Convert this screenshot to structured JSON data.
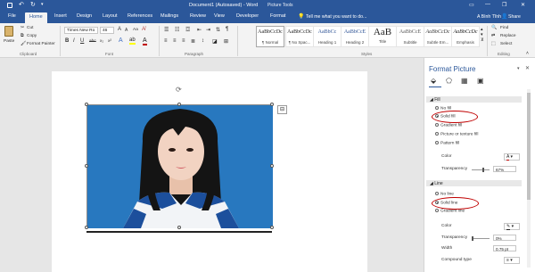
{
  "titlebar": {
    "title": "Document1 (Autosaved) - Word",
    "context_tab_group": "Picture Tools",
    "minimize_icon": "—",
    "restore_icon": "❐",
    "close_icon": "✕"
  },
  "tabs": [
    "File",
    "Home",
    "Insert",
    "Design",
    "Layout",
    "References",
    "Mailings",
    "Review",
    "View",
    "Developer",
    "Format"
  ],
  "tell_me": "Tell me what you want to do...",
  "user": "A Bình Tĩnh",
  "share": "Share",
  "clipboard": {
    "paste": "Paste",
    "cut": "Cut",
    "copy": "Copy",
    "format_painter": "Format Painter",
    "label": "Clipboard"
  },
  "font": {
    "name": "Times New Ro",
    "size": "46",
    "bold": "B",
    "italic": "I",
    "underline": "U",
    "strike": "abc",
    "sub": "x₂",
    "sup": "x²",
    "grow": "A",
    "shrink": "A",
    "case": "Aa",
    "label": "Font"
  },
  "paragraph": {
    "label": "Paragraph"
  },
  "styles": {
    "items": [
      {
        "preview": "AaBbCcDc",
        "name": "¶ Normal"
      },
      {
        "preview": "AaBbCcDc",
        "name": "¶ No Spac..."
      },
      {
        "preview": "AaBbCc",
        "name": "Heading 1"
      },
      {
        "preview": "AaBbCcE",
        "name": "Heading 2"
      },
      {
        "preview": "AaB",
        "name": "Title"
      },
      {
        "preview": "AaBbCcE",
        "name": "Subtitle"
      },
      {
        "preview": "AaBbCcDc",
        "name": "Subtle Em..."
      },
      {
        "preview": "AaBbCcDc",
        "name": "Emphasis"
      }
    ],
    "label": "Styles"
  },
  "editing": {
    "find": "Find",
    "replace": "Replace",
    "select": "Select",
    "label": "Editing"
  },
  "pane": {
    "title": "Format Picture",
    "close": "✕",
    "fill": {
      "header": "Fill",
      "options": [
        "No fill",
        "Solid fill",
        "Gradient fill",
        "Picture or texture fill",
        "Pattern fill"
      ],
      "selected": 1,
      "color_label": "Color",
      "transparency_label": "Transparency",
      "transparency_value": "67%",
      "transparency_fraction": 0.67
    },
    "line": {
      "header": "Line",
      "options": [
        "No line",
        "Solid line",
        "Gradient line"
      ],
      "selected": 1,
      "color_label": "Color",
      "transparency_label": "Transparency",
      "transparency_value": "0%",
      "width_label": "Width",
      "width_value": "0.75 pt",
      "compound_label": "Compound type"
    }
  },
  "colors": {
    "ribbon_blue": "#2b579a",
    "highlight_oval": "#c00000",
    "photo_bg": "#1f6fb5"
  }
}
